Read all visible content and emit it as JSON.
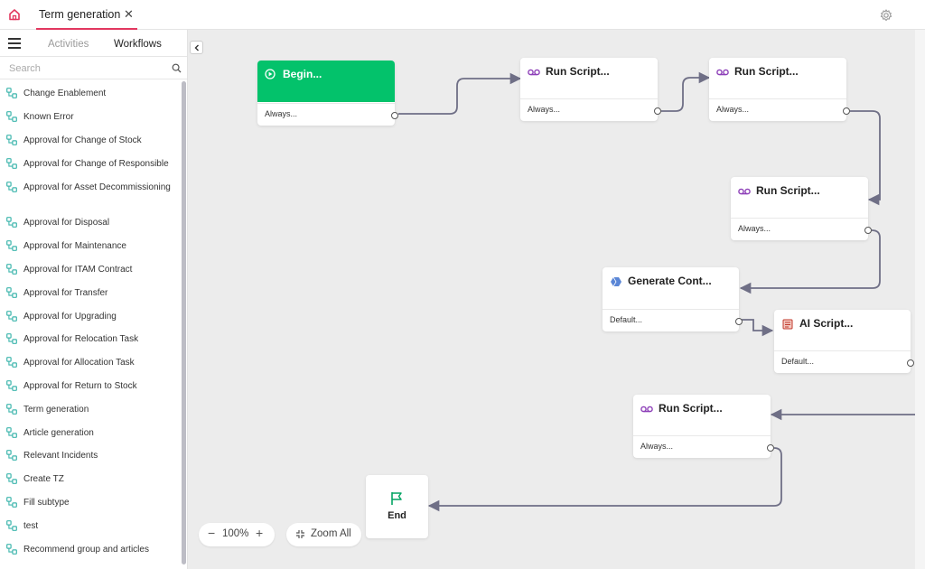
{
  "colors": {
    "accent": "#e2375f",
    "begin": "#03c26b",
    "edge": "#6f6f86",
    "script_icon": "#8d3fb8",
    "wf_icon": "#3fb6ad"
  },
  "header": {
    "tab_label": "Term generation",
    "tab_close": "✕"
  },
  "sidebar": {
    "tabs": {
      "activities": "Activities",
      "workflows": "Workflows"
    },
    "search_placeholder": "Search",
    "items": [
      "Change Enablement",
      "Known Error",
      "Approval for Change of Stock",
      "Approval for Change of Responsible",
      "Approval for Asset Decommissioning",
      "Approval for Disposal",
      "Approval for Maintenance",
      "Approval for ITAM Contract",
      "Approval for Transfer",
      "Approval for Upgrading",
      "Approval for Relocation Task",
      "Approval for Allocation Task",
      "Approval for Return to Stock",
      "Term generation",
      "Article generation",
      "Relevant Incidents",
      "Create TZ",
      "Fill subtype",
      "test",
      "Recommend group and articles"
    ]
  },
  "workflow": {
    "nodes": [
      {
        "id": "begin",
        "title": "Begin...",
        "condition": "Always...",
        "icon": "play-circle-icon",
        "kind": "start"
      },
      {
        "id": "run1",
        "title": "Run Script...",
        "condition": "Always...",
        "icon": "script-icon"
      },
      {
        "id": "run2",
        "title": "Run Script...",
        "condition": "Always...",
        "icon": "script-icon"
      },
      {
        "id": "run3",
        "title": "Run Script...",
        "condition": "Always...",
        "icon": "script-icon"
      },
      {
        "id": "gen",
        "title": "Generate Cont...",
        "condition": "Default...",
        "icon": "ai-cube-icon"
      },
      {
        "id": "ai",
        "title": "AI Script...",
        "condition": "Default...",
        "icon": "ai-script-icon"
      },
      {
        "id": "run4",
        "title": "Run Script...",
        "condition": "Always...",
        "icon": "script-icon"
      }
    ],
    "end_label": "End"
  },
  "zoom": {
    "value": "100%",
    "minus": "−",
    "plus": "+",
    "zoom_all_label": "Zoom All"
  }
}
